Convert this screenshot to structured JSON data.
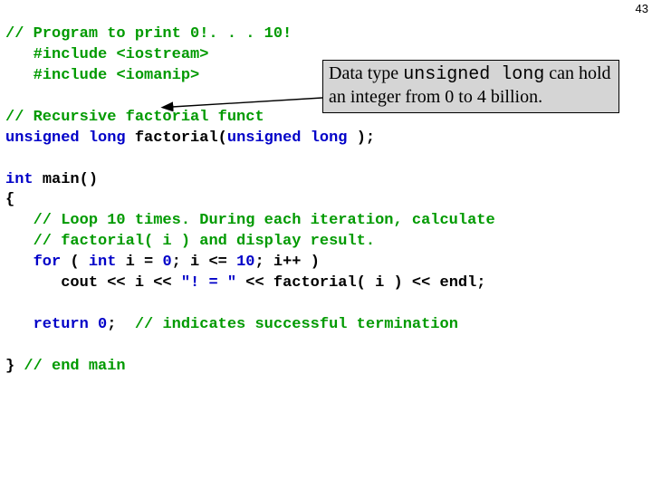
{
  "page_number": "43",
  "code": {
    "l1": "// Program to print 0!. . . 10!",
    "l2a": "#include ",
    "l2b": "<iostream>",
    "l3a": "#include ",
    "l3b": "<iomanip>",
    "l4": "// Recursive factorial funct",
    "l5a": "unsigned",
    "l5b": "long",
    "l5c": "factorial(",
    "l5d": "unsigned",
    "l5e": "long",
    "l5f": ");",
    "l6a": "int",
    "l6b": "main()",
    "l7": "{",
    "l8": "// Loop 10 times. During each iteration, calculate",
    "l9": "// factorial( i ) and display result.",
    "l10a": "for",
    "l10b": "(",
    "l10c": "int",
    "l10d": "i =",
    "l10e": "0",
    "l10f": "; i <=",
    "l10g": "10",
    "l10h": "; i++ )",
    "l11a": "cout << i <<",
    "l11b": "\"! = \"",
    "l11c": "<< factorial( i ) << endl;",
    "l12a": "return",
    "l12b": "0",
    "l12c": ";",
    "l12d": "// indicates successful termination",
    "l13a": "}",
    "l13b": "// end main"
  },
  "callout": {
    "part1": "Data type ",
    "mono": "unsigned long",
    "part2": " can hold an integer from 0 to 4 billion."
  }
}
